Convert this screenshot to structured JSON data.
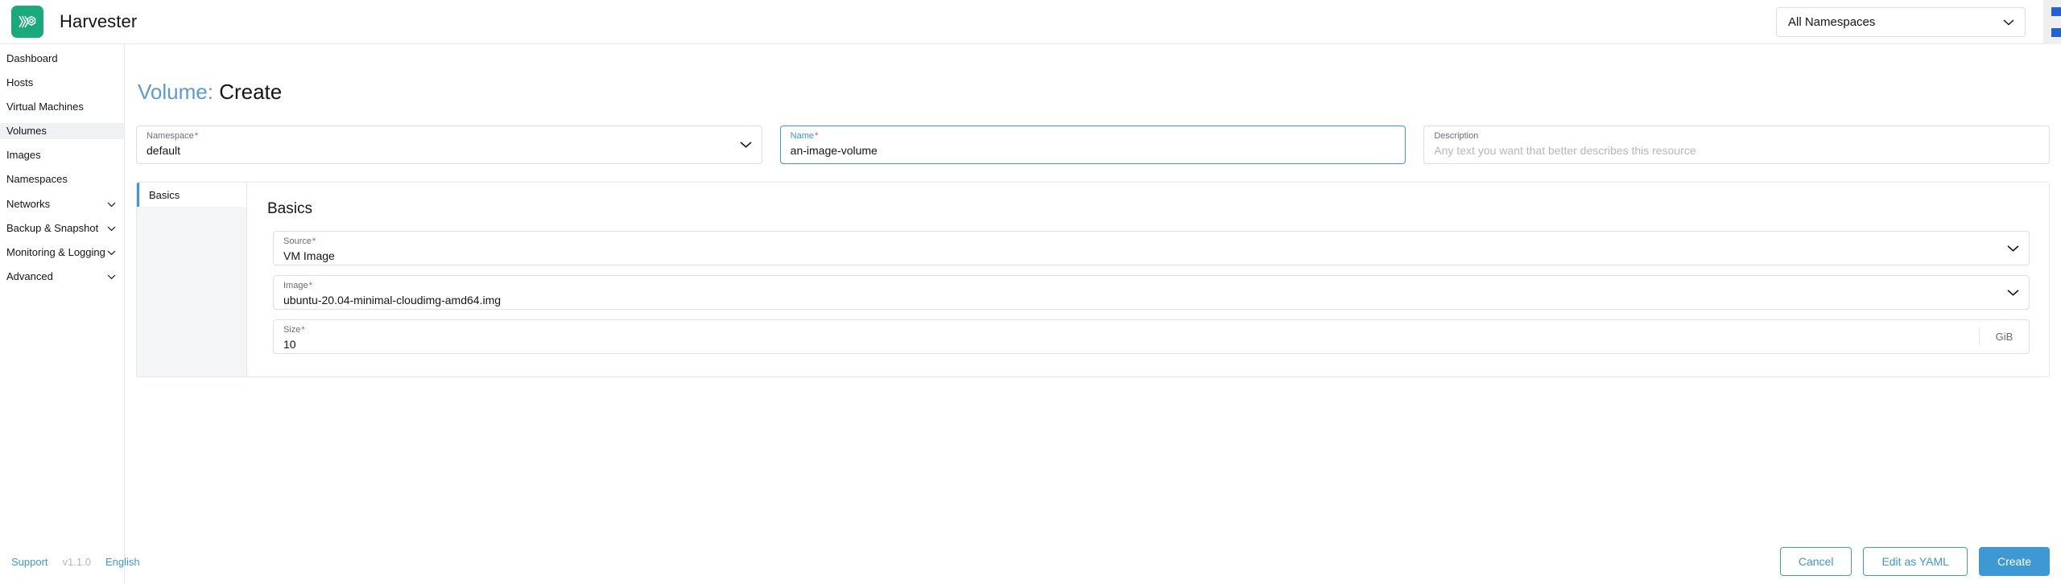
{
  "topbar": {
    "brand": "Harvester",
    "logo_icon": "harvester-logo-icon",
    "logo_color": "#19a97b",
    "namespace_filter": {
      "value": "All Namespaces",
      "chevron_icon": "chevron-down-icon"
    },
    "user_menu_icon": "user-menu-icon"
  },
  "sidebar": {
    "items": [
      {
        "label": "Dashboard",
        "active": false,
        "expandable": false
      },
      {
        "label": "Hosts",
        "active": false,
        "expandable": false
      },
      {
        "label": "Virtual Machines",
        "active": false,
        "expandable": false
      },
      {
        "label": "Volumes",
        "active": true,
        "expandable": false
      },
      {
        "label": "Images",
        "active": false,
        "expandable": false
      },
      {
        "label": "Namespaces",
        "active": false,
        "expandable": false
      },
      {
        "label": "Networks",
        "active": false,
        "expandable": true
      },
      {
        "label": "Backup & Snapshot",
        "active": false,
        "expandable": true
      },
      {
        "label": "Monitoring & Logging",
        "active": false,
        "expandable": true
      },
      {
        "label": "Advanced",
        "active": false,
        "expandable": true
      }
    ],
    "chevron_icon": "chevron-down-icon"
  },
  "page": {
    "title_prefix": "Volume:",
    "title_suffix": "Create",
    "title_accent_color": "#5b9bd5"
  },
  "header_fields": {
    "namespace": {
      "label": "Namespace",
      "required": true,
      "value": "default",
      "chevron_icon": "chevron-down-icon",
      "focused": false
    },
    "name": {
      "label": "Name",
      "required": true,
      "value": "an-image-volume",
      "focused": true,
      "focus_color": "#3d98d3"
    },
    "description": {
      "label": "Description",
      "required": false,
      "value": "",
      "placeholder": "Any text you want that better describes this resource",
      "focused": false
    }
  },
  "tabs": [
    {
      "label": "Basics",
      "active": true
    }
  ],
  "basics_pane": {
    "title": "Basics",
    "fields": {
      "source": {
        "label": "Source",
        "required": true,
        "value": "VM Image",
        "chevron_icon": "chevron-down-icon"
      },
      "image": {
        "label": "Image",
        "required": true,
        "value": "ubuntu-20.04-minimal-cloudimg-amd64.img",
        "chevron_icon": "chevron-down-icon"
      },
      "size": {
        "label": "Size",
        "required": true,
        "value": "10",
        "unit": "GiB"
      }
    }
  },
  "footer": {
    "support_label": "Support",
    "version": "v1.1.0",
    "language": "English",
    "cancel_label": "Cancel",
    "edit_yaml_label": "Edit as YAML",
    "create_label": "Create",
    "primary_color": "#3d98d3"
  }
}
